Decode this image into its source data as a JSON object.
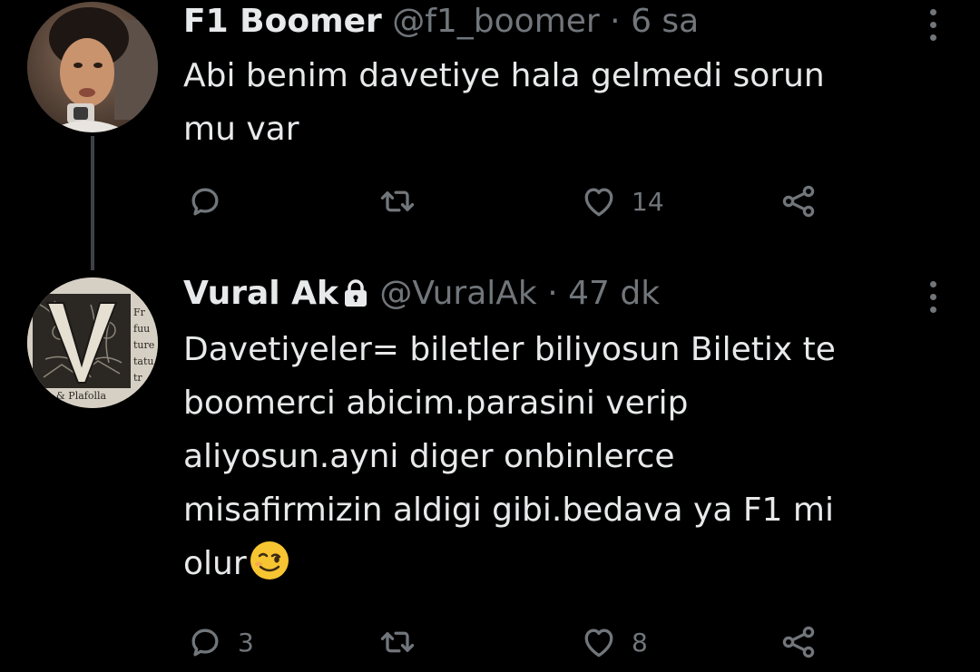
{
  "tweets": [
    {
      "name": "F1 Boomer",
      "handle": "@f1_boomer",
      "separator": "·",
      "time": "6 sa",
      "text_lines": [
        "Abi benim davetiye hala gelmedi sorun",
        "mu var"
      ],
      "reply_count": "",
      "retweet_count": "",
      "like_count": "14",
      "avatar_icon": "profile-photo"
    },
    {
      "name": "Vural Ak",
      "protected_icon": "lock-icon",
      "handle": "@VuralAk",
      "separator": "·",
      "time": "47 dk",
      "text_lines": [
        "Davetiyeler= biletler biliyosun Biletix te",
        "boomerci abicim.parasini verip",
        "aliyosun.ayni diger onbinlerce",
        "misafirmizin aldigi gibi.bedava ya F1 mi",
        "olur"
      ],
      "emoji": "winking-face",
      "reply_count": "3",
      "retweet_count": "",
      "like_count": "8",
      "avatar_icon": "engraved-letter-v",
      "avatar_caption": "& Plafolla"
    }
  ],
  "colors": {
    "background": "#000000",
    "primary_text": "#e7e9ea",
    "secondary_text": "#71767b",
    "thread_line": "#3e4144"
  }
}
